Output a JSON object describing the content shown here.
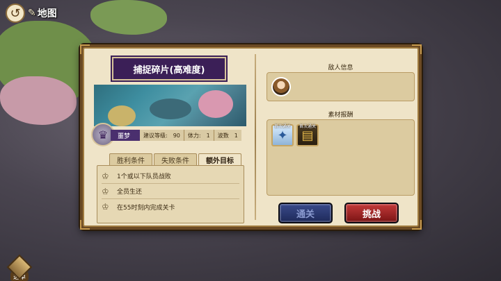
{
  "top_bar": {
    "map_label": "地图"
  },
  "bottom_menu": {
    "label": "选单"
  },
  "dialog": {
    "stage_title": "捕捉碎片(高难度)",
    "stage_name": "噩梦",
    "stats": [
      {
        "label": "建议等级:",
        "value": "90"
      },
      {
        "label": "体力:",
        "value": "1"
      },
      {
        "label": "波数",
        "value": "1"
      }
    ],
    "tabs": [
      {
        "label": "胜利条件",
        "active": false
      },
      {
        "label": "失败条件",
        "active": false
      },
      {
        "label": "额外目标",
        "active": true
      }
    ],
    "goals": [
      "1个或以下队员战败",
      "全员生还",
      "在55时刻内完成关卡"
    ],
    "enemy_section_title": "敌人信息",
    "reward_section_title": "素材报酬",
    "rewards": [
      {
        "icon": "crystal-icon",
        "tag": "首次通关"
      },
      {
        "icon": "book-icon",
        "tag": "首次通关"
      }
    ],
    "buttons": {
      "clear": "通关",
      "challenge": "挑战"
    }
  },
  "colors": {
    "accent_purple": "#3b1f57",
    "challenge_red": "#c43a3a",
    "clear_blue": "#3a4a8a",
    "panel_bg": "#efe4c8"
  }
}
